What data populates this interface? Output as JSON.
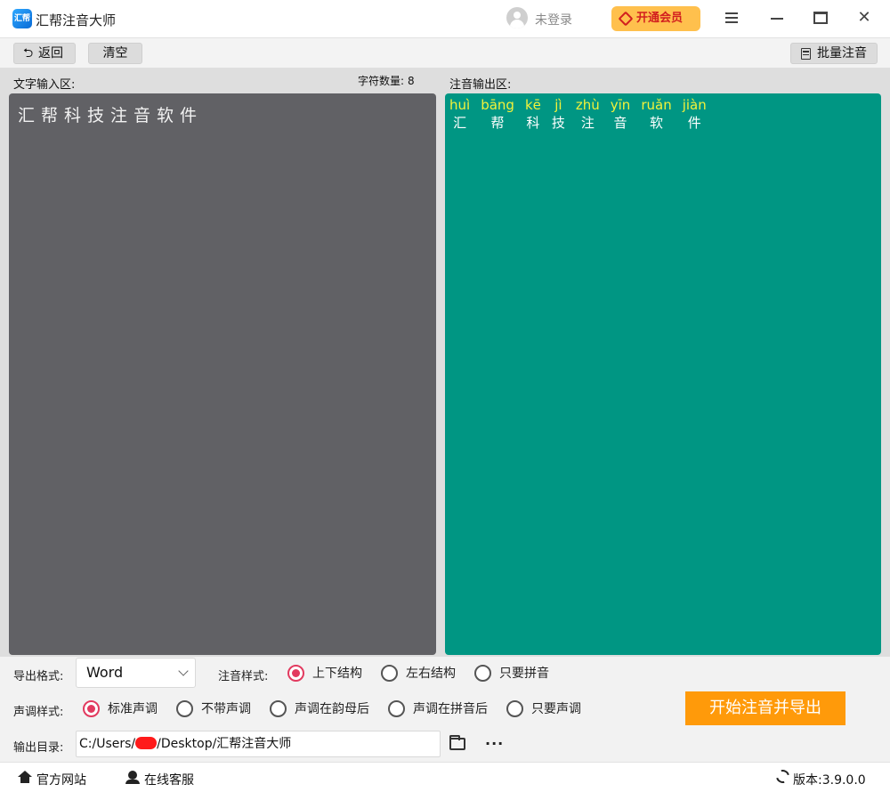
{
  "app": {
    "title": "汇帮注音大师",
    "logo_text": "汇帮"
  },
  "header": {
    "login_text": "未登录",
    "vip_label": "开通会员"
  },
  "toolbar": {
    "back_label": "返回",
    "clear_label": "清空",
    "batch_label": "批量注音"
  },
  "input_area": {
    "label": "文字输入区:",
    "char_count_label": "字符数量:",
    "char_count": "8",
    "text": "汇帮科技注音软件"
  },
  "output_area": {
    "label": "注音输出区:",
    "items": [
      {
        "pinyin": "huì",
        "hanzi": "汇"
      },
      {
        "pinyin": "bāng",
        "hanzi": "帮"
      },
      {
        "pinyin": "kē",
        "hanzi": "科"
      },
      {
        "pinyin": "jì",
        "hanzi": "技"
      },
      {
        "pinyin": "zhù",
        "hanzi": "注"
      },
      {
        "pinyin": "yīn",
        "hanzi": "音"
      },
      {
        "pinyin": "ruǎn",
        "hanzi": "软"
      },
      {
        "pinyin": "jiàn",
        "hanzi": "件"
      }
    ]
  },
  "options": {
    "format_label": "导出格式:",
    "format_value": "Word",
    "style_label": "注音样式:",
    "style_options": [
      "上下结构",
      "左右结构",
      "只要拼音"
    ],
    "style_selected": "上下结构",
    "tone_label": "声调样式:",
    "tone_options": [
      "标准声调",
      "不带声调",
      "声调在韵母后",
      "声调在拼音后",
      "只要声调"
    ],
    "tone_selected": "标准声调",
    "output_dir_label": "输出目录:",
    "output_path_prefix": "C:/Users/",
    "output_path_suffix": "/Desktop/汇帮注音大师",
    "export_label": "开始注音并导出",
    "more_label": "···"
  },
  "statusbar": {
    "website_label": "官方网站",
    "service_label": "在线客服",
    "version_label": "版本:",
    "version": "3.9.0.0"
  },
  "colors": {
    "input_bg": "#616165",
    "output_bg": "#009683",
    "pinyin": "#f3f23a",
    "accent": "#ff9a0a",
    "radio_on": "#e23a5f"
  }
}
